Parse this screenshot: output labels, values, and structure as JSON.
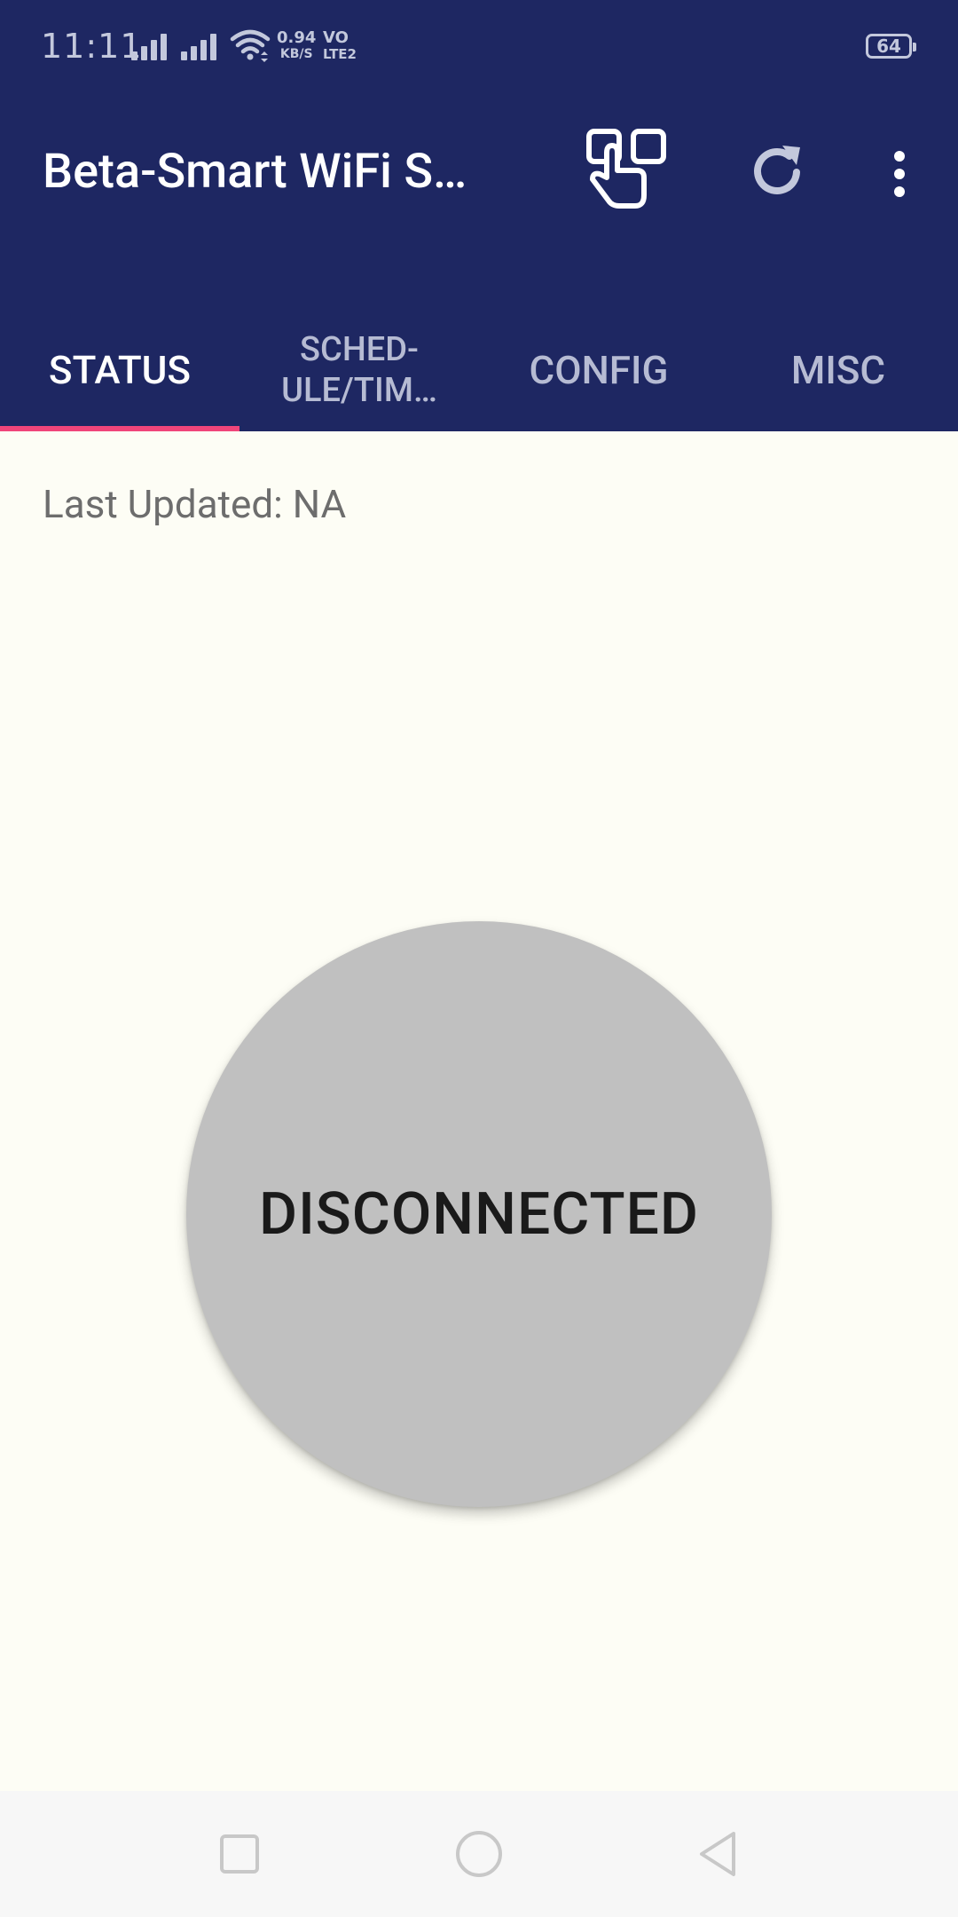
{
  "status_bar": {
    "time": "11:11",
    "net_speed_value": "0.94",
    "net_speed_unit": "KB/S",
    "volte_top": "VO",
    "volte_bottom": "LTE2",
    "battery_level": "64"
  },
  "app_bar": {
    "title": "Beta-Smart WiFi S…",
    "actions": [
      "tap-switch-icon",
      "refresh-icon",
      "overflow-menu-icon"
    ]
  },
  "tabs": {
    "items": [
      "STATUS",
      "SCHED-\nULE/TIM…",
      "CONFIG",
      "MISC"
    ],
    "active_index": 0
  },
  "content": {
    "last_updated": "Last Updated: NA",
    "connection_status": "DISCONNECTED"
  },
  "nav_bar": {
    "buttons": [
      "recents-icon",
      "home-icon",
      "back-icon"
    ]
  },
  "colors": {
    "primary": "#1e2762",
    "tab_indicator": "#f0457a",
    "background": "#fdfdf5",
    "status_circle": "#c0c0c0"
  }
}
